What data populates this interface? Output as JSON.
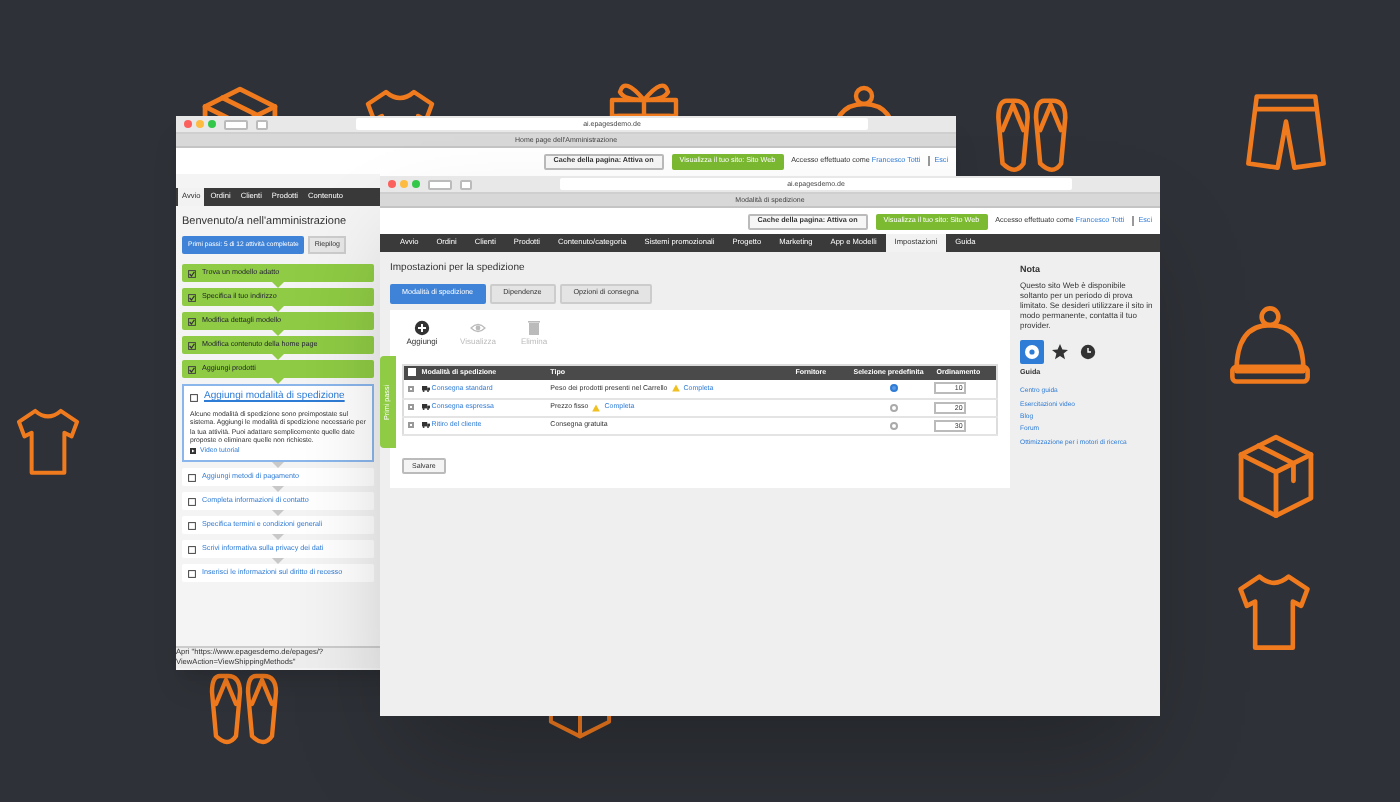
{
  "back_window": {
    "address": "ai.epagesdemo.de",
    "tab_title": "Home page dell'Amministrazione",
    "cache_button": "Cache della pagina: Attiva on",
    "site_button": "Visualizza il tuo sito: Sito Web",
    "login_text": "Accesso effettuato come",
    "user_link": "Francesco Totti",
    "logout_link": "Esci",
    "nav": [
      {
        "label": "Avvio",
        "selected": true
      },
      {
        "label": "Ordini",
        "selected": false
      },
      {
        "label": "Clienti",
        "selected": false
      },
      {
        "label": "Prodotti",
        "selected": false
      },
      {
        "label": "Contenuto",
        "selected": false
      }
    ],
    "heading": "Benvenuto/a nell'amministrazione",
    "progress_button": "Primi passi: 5 di 12 attività completate",
    "summary_tab": "Riepilog",
    "steps": [
      {
        "label": "Trova un modello adatto",
        "kind": "done"
      },
      {
        "label": "Specifica il tuo indirizzo",
        "kind": "done"
      },
      {
        "label": "Modifica dettagli modello",
        "kind": "done"
      },
      {
        "label": "Modifica contenuto della home page",
        "kind": "done"
      },
      {
        "label": "Aggiungi prodotti",
        "kind": "done"
      },
      {
        "label": "Aggiungi modalità di spedizione",
        "kind": "current",
        "description": "Alcune modalità di spedizione sono preimpostate sul sistema. Aggiungi le modalità di spedizione necessarie per la tua attività. Puoi adattare semplicemente quelle date proposte o eliminare quelle non richieste.",
        "video_link": "Video tutorial"
      },
      {
        "label": "Aggiungi metodi di pagamento",
        "kind": "todo"
      },
      {
        "label": "Completa informazioni di contatto",
        "kind": "todo"
      },
      {
        "label": "Specifica termini e condizioni generali",
        "kind": "todo"
      },
      {
        "label": "Scrivi informativa sulla privacy dei dati",
        "kind": "todo"
      },
      {
        "label": "Inserisci le informazioni sul diritto di recesso",
        "kind": "todo"
      }
    ],
    "status_url": "Apri \"https://www.epagesdemo.de/epages/?ViewAction=ViewShippingMethods\""
  },
  "front_window": {
    "address": "ai.epagesdemo.de",
    "tab_title": "Modalità di spedizione",
    "cache_button": "Cache della pagina: Attiva on",
    "site_button": "Visualizza il tuo sito: Sito Web",
    "login_text": "Accesso effettuato come",
    "user_link": "Francesco Totti",
    "logout_link": "Esci",
    "nav": [
      {
        "label": "Avvio",
        "selected": false
      },
      {
        "label": "Ordini",
        "selected": false
      },
      {
        "label": "Clienti",
        "selected": false
      },
      {
        "label": "Prodotti",
        "selected": false
      },
      {
        "label": "Contenuto/categoria",
        "selected": false
      },
      {
        "label": "Sistemi promozionali",
        "selected": false
      },
      {
        "label": "Progetto",
        "selected": false
      },
      {
        "label": "Marketing",
        "selected": false
      },
      {
        "label": "App e Modelli",
        "selected": false
      },
      {
        "label": "Impostazioni",
        "selected": true
      },
      {
        "label": "Guida",
        "selected": false
      }
    ],
    "heading": "Impostazioni per la spedizione",
    "tabs": [
      {
        "label": "Modalità di spedizione",
        "selected": true
      },
      {
        "label": "Dipendenze",
        "selected": false
      },
      {
        "label": "Opzioni di consegna",
        "selected": false
      }
    ],
    "actions": [
      {
        "label": "Aggiungi",
        "kind": "add",
        "disabled": false
      },
      {
        "label": "Visualizza",
        "kind": "view",
        "disabled": true
      },
      {
        "label": "Elimina",
        "kind": "delete",
        "disabled": true
      }
    ],
    "table": {
      "select_all_checked": false,
      "columns": [
        "Modalità di spedizione",
        "Tipo",
        "Fornitore",
        "Selezione predefinita",
        "Ordinamento"
      ],
      "rows": [
        {
          "checked": false,
          "name": "Consegna standard",
          "type": "Peso dei prodotti presenti nel Carrello",
          "warning_link": "Completa",
          "selected": true,
          "order": "10"
        },
        {
          "checked": false,
          "name": "Consegna espressa",
          "type": "Prezzo fisso",
          "warning_link": "Completa",
          "selected": false,
          "order": "20"
        },
        {
          "checked": false,
          "name": "Ritiro del cliente",
          "type": "Consegna gratuita",
          "selected": false,
          "order": "30"
        }
      ]
    },
    "save_button": "Salvare",
    "side_tab": "Primi passi",
    "note_title": "Nota",
    "note_text": "Questo sito Web è disponibile soltanto per un periodo di prova limitato. Se desideri utilizzare il sito in modo permanente, contatta il tuo provider.",
    "help_icons": [
      {
        "kind": "help",
        "selected": true
      },
      {
        "kind": "star",
        "selected": false
      },
      {
        "kind": "clock",
        "selected": false
      }
    ],
    "help_title": "Guida",
    "help_links": [
      "Centro guida",
      "Esercitazioni video",
      "Blog",
      "Forum",
      "Ottimizzazione per i motori di ricerca"
    ]
  }
}
